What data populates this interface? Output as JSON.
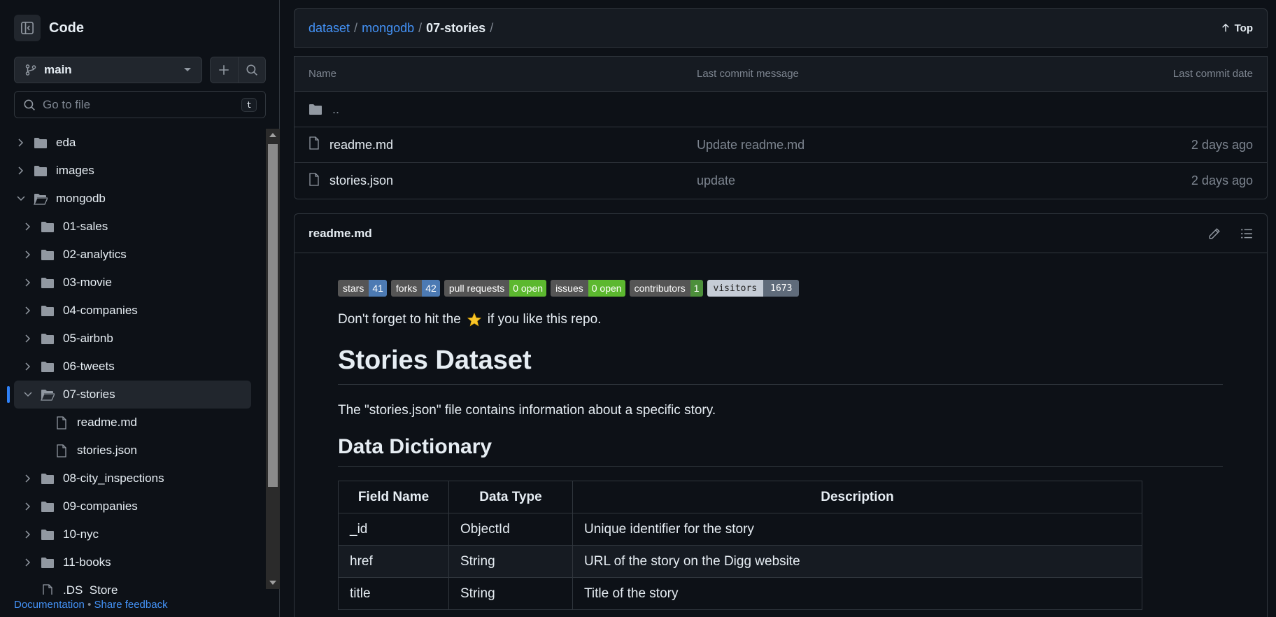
{
  "sidebar": {
    "title": "Code",
    "branch": "main",
    "goto_placeholder": "Go to file",
    "goto_shortcut": "t",
    "tree": [
      {
        "name": "eda",
        "type": "folder",
        "depth": 0,
        "expanded": false
      },
      {
        "name": "images",
        "type": "folder",
        "depth": 0,
        "expanded": false
      },
      {
        "name": "mongodb",
        "type": "folder",
        "depth": 0,
        "expanded": true
      },
      {
        "name": "01-sales",
        "type": "folder",
        "depth": 1,
        "expanded": false
      },
      {
        "name": "02-analytics",
        "type": "folder",
        "depth": 1,
        "expanded": false
      },
      {
        "name": "03-movie",
        "type": "folder",
        "depth": 1,
        "expanded": false
      },
      {
        "name": "04-companies",
        "type": "folder",
        "depth": 1,
        "expanded": false
      },
      {
        "name": "05-airbnb",
        "type": "folder",
        "depth": 1,
        "expanded": false
      },
      {
        "name": "06-tweets",
        "type": "folder",
        "depth": 1,
        "expanded": false
      },
      {
        "name": "07-stories",
        "type": "folder",
        "depth": 1,
        "expanded": true,
        "active": true
      },
      {
        "name": "readme.md",
        "type": "file",
        "depth": 2
      },
      {
        "name": "stories.json",
        "type": "file",
        "depth": 2
      },
      {
        "name": "08-city_inspections",
        "type": "folder",
        "depth": 1,
        "expanded": false
      },
      {
        "name": "09-companies",
        "type": "folder",
        "depth": 1,
        "expanded": false
      },
      {
        "name": "10-nyc",
        "type": "folder",
        "depth": 1,
        "expanded": false
      },
      {
        "name": "11-books",
        "type": "folder",
        "depth": 1,
        "expanded": false
      },
      {
        "name": ".DS_Store",
        "type": "file",
        "depth": 1
      }
    ],
    "footer": {
      "documentation": "Documentation",
      "bullet": "•",
      "feedback": "Share feedback"
    }
  },
  "breadcrumb": {
    "items": [
      "dataset",
      "mongodb"
    ],
    "current": "07-stories",
    "sep": "/",
    "top_label": "Top"
  },
  "file_table": {
    "headers": {
      "name": "Name",
      "message": "Last commit message",
      "date": "Last commit date"
    },
    "parent": "..",
    "rows": [
      {
        "name": "readme.md",
        "message": "Update readme.md",
        "date": "2 days ago"
      },
      {
        "name": "stories.json",
        "message": "update",
        "date": "2 days ago"
      }
    ]
  },
  "readme": {
    "title": "readme.md",
    "badges": [
      {
        "label": "stars",
        "value": "41",
        "color": "#4c7ab3"
      },
      {
        "label": "forks",
        "value": "42",
        "color": "#4c7ab3"
      },
      {
        "label": "pull requests",
        "value": "0 open",
        "color": "#5cb82f"
      },
      {
        "label": "issues",
        "value": "0 open",
        "color": "#5cb82f"
      },
      {
        "label": "contributors",
        "value": "1",
        "color": "#4c8f3a"
      },
      {
        "label": "visitors",
        "value": "1673",
        "color": "#5f6b7a",
        "style": "vis"
      }
    ],
    "star_before": "Don't forget to hit the",
    "star_after": "if you like this repo.",
    "h1": "Stories Dataset",
    "intro": "The \"stories.json\" file contains information about a specific story.",
    "h2": "Data Dictionary",
    "table_headers": [
      "Field Name",
      "Data Type",
      "Description"
    ],
    "table_rows": [
      [
        "_id",
        "ObjectId",
        "Unique identifier for the story"
      ],
      [
        "href",
        "String",
        "URL of the story on the Digg website"
      ],
      [
        "title",
        "String",
        "Title of the story"
      ]
    ]
  },
  "colors": {
    "accent": "#2f81f7",
    "link": "#4493f8",
    "bg": "#0d1117",
    "border": "#30363d"
  }
}
